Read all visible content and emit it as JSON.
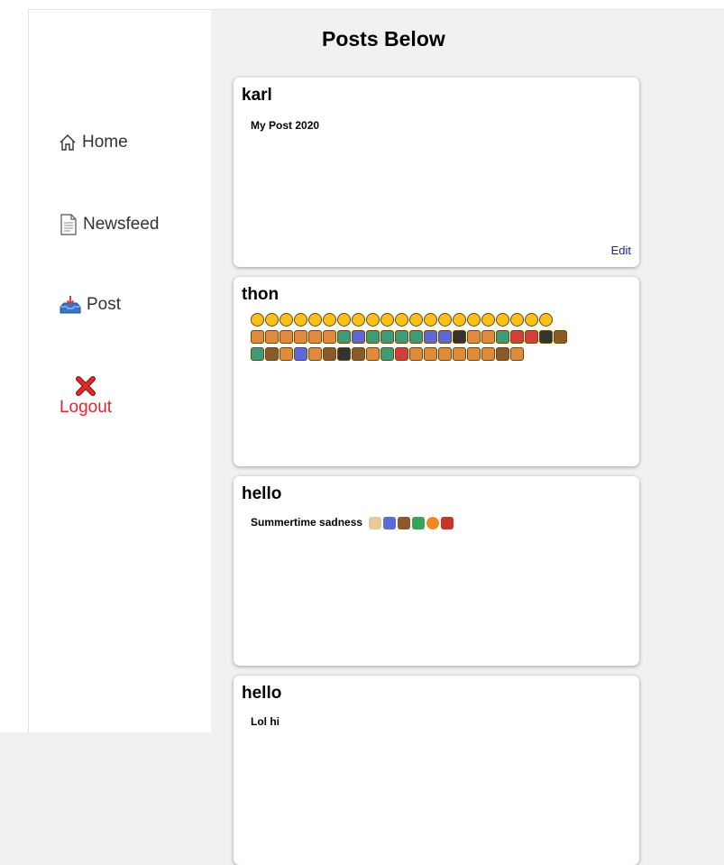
{
  "sidebar": {
    "items": [
      {
        "label": "Home",
        "icon": "home-icon"
      },
      {
        "label": "Newsfeed",
        "icon": "newspaper-icon"
      },
      {
        "label": "Post",
        "icon": "inbox-tray-icon"
      }
    ],
    "logout": {
      "label": "Logout",
      "icon": "cross-mark-icon"
    }
  },
  "main": {
    "title": "Posts Below",
    "posts": [
      {
        "author": "karl",
        "body": "My Post 2020",
        "action": "Edit"
      },
      {
        "author": "thon",
        "body": ""
      },
      {
        "author": "hello",
        "body": "Summertime sadness"
      },
      {
        "author": "hello",
        "body": "Lol hi"
      }
    ]
  },
  "colors": {
    "background": "#f1f1f3",
    "logout": "#e3242b",
    "link": "#1a1acc"
  }
}
